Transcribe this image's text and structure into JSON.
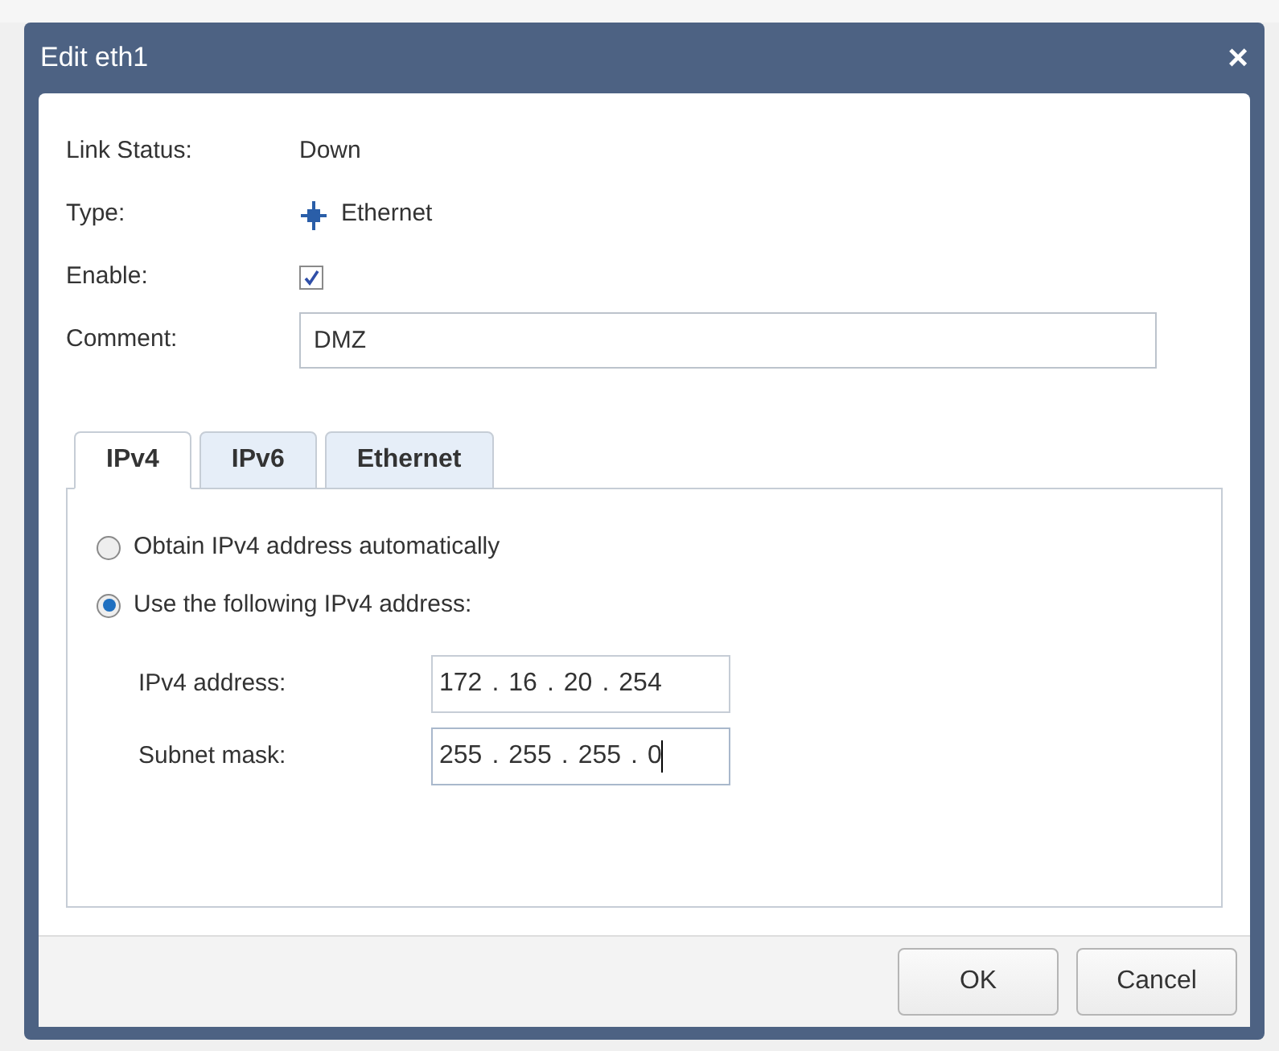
{
  "window": {
    "title": "Edit eth1",
    "close": "×"
  },
  "properties": [
    {
      "kind": "text",
      "label": "Link Status:",
      "value": "Down"
    },
    {
      "kind": "type",
      "label": "Type:",
      "value": "Ethernet"
    },
    {
      "kind": "checkbox",
      "label": "Enable:",
      "checked": true
    },
    {
      "kind": "field",
      "label": "Comment:",
      "value": "DMZ"
    }
  ],
  "tabs": [
    {
      "label": "IPv4",
      "selected": true
    },
    {
      "label": "IPv6",
      "selected": false
    },
    {
      "label": "Ethernet",
      "selected": false
    }
  ],
  "radios": [
    {
      "label": "Obtain IPv4 address automatically",
      "selected": false
    },
    {
      "label": "Use the following IPv4 address:",
      "selected": true
    }
  ],
  "address_fields": [
    {
      "label": "IPv4 address:",
      "octets": [
        "172",
        "16",
        "20",
        "254"
      ],
      "separator": ".",
      "focused": false
    },
    {
      "label": "Subnet mask:",
      "octets": [
        "255",
        "255",
        "255",
        "0"
      ],
      "separator": ".",
      "focused": true
    }
  ],
  "buttons": [
    "OK",
    "Cancel"
  ]
}
